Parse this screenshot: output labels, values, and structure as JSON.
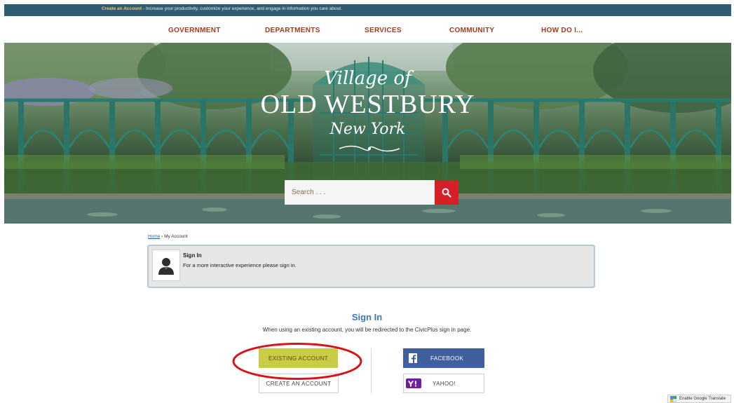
{
  "topbar": {
    "link": "Create an Account",
    "message": " - Increase your productivity, customize your experience, and engage in information you care about."
  },
  "nav": {
    "items": [
      "GOVERNMENT",
      "DEPARTMENTS",
      "SERVICES",
      "COMMUNITY",
      "HOW DO I..."
    ]
  },
  "banner": {
    "village": "Village of",
    "city": "OLD WESTBURY",
    "state": "New York",
    "search_placeholder": "Search . . ."
  },
  "breadcrumb": {
    "home": "Home",
    "separator": " › ",
    "current": "My Account"
  },
  "notice": {
    "title": "Sign In",
    "subtitle": "For a more interactive experience please sign in."
  },
  "signin": {
    "title": "Sign In",
    "description": "When using an existing account, you will be redirected to the CivicPlus sign in page.",
    "existing_label": "EXISTING ACCOUNT",
    "create_label": "CREATE AN ACCOUNT",
    "facebook_label": "FACEBOOK",
    "yahoo_label": "YAHOO!"
  },
  "translate": {
    "label": "Enable Google Translate"
  },
  "colors": {
    "topbar": "#2f5b73",
    "nav_text": "#a33a1d",
    "search_button": "#d61f26",
    "existing_button": "#c8cc46",
    "facebook": "#3f5f9f",
    "yahoo": "#6e1e9f",
    "highlight_ring": "#d8141a",
    "signin_title": "#3a78b7"
  },
  "icons": {
    "search": "search-icon",
    "user": "user-silhouette-icon",
    "facebook": "facebook-icon",
    "yahoo": "yahoo-icon",
    "translate": "google-translate-icon"
  }
}
